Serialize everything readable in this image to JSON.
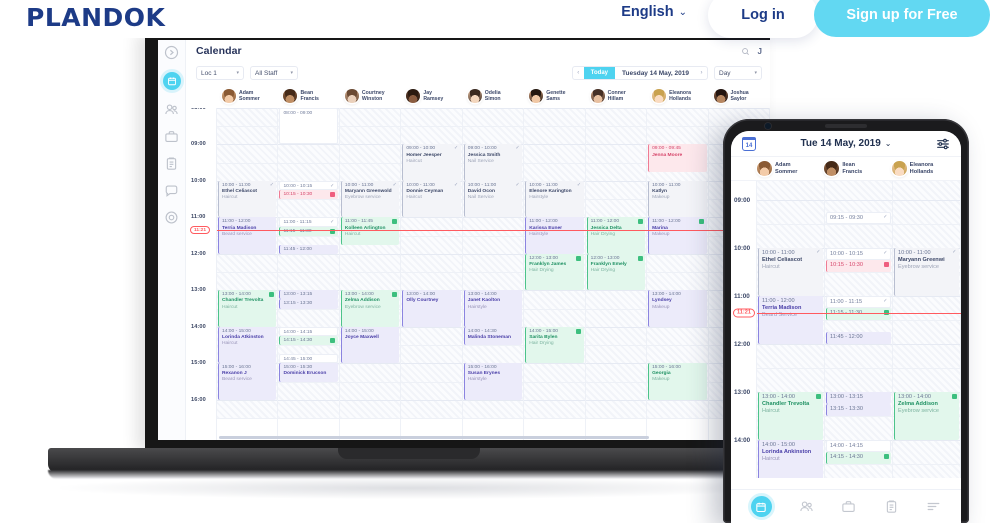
{
  "topnav": {
    "brand": "PLANDOK",
    "language": "English",
    "caret": "⌄",
    "login_label": "Log in",
    "signup_label": "Sign up for Free",
    "accent_cyan": "#62d8f2",
    "brand_navy": "#1d3b87"
  },
  "app": {
    "title": "Calendar",
    "avatar_initial": "J",
    "toolbar": {
      "location": "Loc 1",
      "staff_filter": "All Staff",
      "prev": "‹",
      "next": "›",
      "today": "Today",
      "date": "Tuesday 14 May, 2019",
      "view": "Day"
    },
    "staff": [
      {
        "name1": "Adam",
        "name2": "Sommer"
      },
      {
        "name1": "Bean",
        "name2": "Francis"
      },
      {
        "name1": "Courtney",
        "name2": "Winston"
      },
      {
        "name1": "Jay",
        "name2": "Ramsey"
      },
      {
        "name1": "Odelia",
        "name2": "Simon"
      },
      {
        "name1": "Genette",
        "name2": "Sams"
      },
      {
        "name1": "Conner",
        "name2": "Hillam"
      },
      {
        "name1": "Eleanora",
        "name2": "Hollands"
      },
      {
        "name1": "Joshua",
        "name2": "Saylor"
      }
    ],
    "times": [
      "08:00",
      "09:00",
      "10:00",
      "11:00",
      "12:00",
      "13:00",
      "14:00",
      "15:00",
      "16:00"
    ],
    "now_marker": "11:21",
    "appointments": [
      {
        "col": 0,
        "time": "10:00 - 11:00",
        "name": "Ethel Celiascot",
        "service": "Haircut",
        "variant": "v-grey",
        "badge": "check"
      },
      {
        "col": 0,
        "time": "11:00 - 12:00",
        "name": "Terria Madison",
        "service": "Beard service",
        "variant": "v-purple",
        "badge": ""
      },
      {
        "col": 0,
        "time": "13:00 - 14:00",
        "name": "Chandler Trevolta",
        "service": "Haircut",
        "variant": "v-green",
        "badge": "green"
      },
      {
        "col": 0,
        "time": "14:00 - 15:00",
        "name": "Lorinda Atkinston",
        "service": "Haircut",
        "variant": "v-purple",
        "badge": ""
      },
      {
        "col": 0,
        "time": "15:00 - 16:00",
        "name": "Rexanon J",
        "service": "Beard service",
        "variant": "v-purple",
        "badge": ""
      },
      {
        "col": 1,
        "time": "08:00 - 09:00",
        "name": "",
        "service": "",
        "variant": "v-white",
        "badge": ""
      },
      {
        "col": 1,
        "time": "10:00 - 10:15",
        "name": "",
        "service": "",
        "variant": "v-white",
        "badge": "check"
      },
      {
        "col": 1,
        "time": "10:15 - 10:30",
        "name": "",
        "service": "",
        "variant": "v-red",
        "badge": "red"
      },
      {
        "col": 1,
        "time": "11:00 - 11:15",
        "name": "",
        "service": "",
        "variant": "v-white",
        "badge": "check"
      },
      {
        "col": 1,
        "time": "11:15 - 11:30",
        "name": "",
        "service": "",
        "variant": "v-green",
        "badge": "green"
      },
      {
        "col": 1,
        "time": "11:45 - 12:00",
        "name": "",
        "service": "",
        "variant": "v-purple",
        "badge": ""
      },
      {
        "col": 1,
        "time": "13:00 - 13:15",
        "name": "",
        "service": "",
        "variant": "v-purple",
        "badge": ""
      },
      {
        "col": 1,
        "time": "13:15 - 13:30",
        "name": "",
        "service": "",
        "variant": "v-purple",
        "badge": ""
      },
      {
        "col": 1,
        "time": "14:00 - 14:15",
        "name": "",
        "service": "",
        "variant": "v-white",
        "badge": ""
      },
      {
        "col": 1,
        "time": "14:15 - 14:30",
        "name": "",
        "service": "",
        "variant": "v-green",
        "badge": "green"
      },
      {
        "col": 1,
        "time": "14:45 - 15:00",
        "name": "",
        "service": "",
        "variant": "v-white",
        "badge": ""
      },
      {
        "col": 1,
        "time": "15:00 - 15:30",
        "name": "Dominick Erucson",
        "service": "",
        "variant": "v-purple",
        "badge": ""
      },
      {
        "col": 2,
        "time": "10:00 - 11:00",
        "name": "Maryann Greenwold",
        "service": "Eyebrow service",
        "variant": "v-grey",
        "badge": "check"
      },
      {
        "col": 2,
        "time": "11:00 - 11:45",
        "name": "Kolleen Arlington",
        "service": "Haircut",
        "variant": "v-green",
        "badge": "green"
      },
      {
        "col": 2,
        "time": "13:00 - 14:00",
        "name": "Zelma Addison",
        "service": "Eyebrow service",
        "variant": "v-green",
        "badge": "green"
      },
      {
        "col": 2,
        "time": "14:00 - 15:00",
        "name": "Joyce Maxwell",
        "service": "",
        "variant": "v-purple",
        "badge": ""
      },
      {
        "col": 3,
        "time": "09:00 - 10:00",
        "name": "Homer Jeesper",
        "service": "Haircut",
        "variant": "v-grey",
        "badge": "check"
      },
      {
        "col": 3,
        "time": "10:00 - 11:00",
        "name": "Donnie Ceyman",
        "service": "Haircut",
        "variant": "v-grey",
        "badge": "check"
      },
      {
        "col": 3,
        "time": "13:00 - 14:00",
        "name": "Olly Courtney",
        "service": "",
        "variant": "v-purple",
        "badge": ""
      },
      {
        "col": 4,
        "time": "09:00 - 10:00",
        "name": "Jessica Smith",
        "service": "Nail Service",
        "variant": "v-grey",
        "badge": "check"
      },
      {
        "col": 4,
        "time": "10:00 - 11:00",
        "name": "David Ocon",
        "service": "Nail Service",
        "variant": "v-grey",
        "badge": "check"
      },
      {
        "col": 4,
        "time": "13:00 - 14:00",
        "name": "Janet Kaolton",
        "service": "Hairstyle",
        "variant": "v-purple",
        "badge": ""
      },
      {
        "col": 4,
        "time": "14:00 - 14:30",
        "name": "Malinda Stoneman",
        "service": "",
        "variant": "v-purple",
        "badge": ""
      },
      {
        "col": 4,
        "time": "15:00 - 16:00",
        "name": "Susan Erynes",
        "service": "Hairstyle",
        "variant": "v-purple",
        "badge": ""
      },
      {
        "col": 5,
        "time": "10:00 - 11:00",
        "name": "Elenore Karington",
        "service": "Hairstyle",
        "variant": "v-grey",
        "badge": "check"
      },
      {
        "col": 5,
        "time": "11:00 - 12:00",
        "name": "Karissa Euner",
        "service": "Hairstyle",
        "variant": "v-purple",
        "badge": ""
      },
      {
        "col": 5,
        "time": "12:00 - 13:00",
        "name": "Franklyn James",
        "service": "Hair Drying",
        "variant": "v-green",
        "badge": "green"
      },
      {
        "col": 5,
        "time": "14:00 - 15:00",
        "name": "Sarita Bylen",
        "service": "Hair Drying",
        "variant": "v-green",
        "badge": "green"
      },
      {
        "col": 6,
        "time": "11:00 - 12:00",
        "name": "Jessica Delta",
        "service": "Hair Drying",
        "variant": "v-green",
        "badge": "green"
      },
      {
        "col": 6,
        "time": "12:00 - 13:00",
        "name": "Franklyn Emely",
        "service": "Hair Drying",
        "variant": "v-green",
        "badge": "green"
      },
      {
        "col": 7,
        "time": "09:00 - 09:45",
        "name": "Jenna Moore",
        "service": "",
        "variant": "v-red",
        "badge": ""
      },
      {
        "col": 7,
        "time": "10:00 - 11:00",
        "name": "Katlyn",
        "service": "Makeup",
        "variant": "v-grey",
        "badge": ""
      },
      {
        "col": 7,
        "time": "11:00 - 12:00",
        "name": "Marina",
        "service": "Makeup",
        "variant": "v-purple",
        "badge": "green"
      },
      {
        "col": 7,
        "time": "13:00 - 14:00",
        "name": "Lyndsey",
        "service": "Makeup",
        "variant": "v-purple",
        "badge": ""
      },
      {
        "col": 7,
        "time": "15:00 - 16:00",
        "name": "Georgia",
        "service": "Makeup",
        "variant": "v-green",
        "badge": ""
      }
    ]
  },
  "phone": {
    "date": "Tue 14 May, 2019",
    "caret": "⌄",
    "cal_day": "14",
    "staff": [
      {
        "name1": "Adam",
        "name2": "Sommer"
      },
      {
        "name1": "Ilean",
        "name2": "Francis"
      },
      {
        "name1": "Eleanora",
        "name2": "Hollands"
      }
    ],
    "times": [
      "09:00",
      "10:00",
      "11:00",
      "12:00",
      "13:00",
      "14:00"
    ],
    "now_marker": "11:21",
    "appointments": [
      {
        "col": 1,
        "time": "09:15 - 09:30",
        "name": "",
        "service": "",
        "variant": "v-white",
        "badge": "check"
      },
      {
        "col": 0,
        "time": "10:00 - 11:00",
        "name": "Ethel Celiascot",
        "service": "Haircut",
        "variant": "v-grey",
        "badge": "check"
      },
      {
        "col": 1,
        "time": "10:00 - 10:15",
        "name": "",
        "service": "",
        "variant": "v-white",
        "badge": "check"
      },
      {
        "col": 1,
        "time": "10:15 - 10:30",
        "name": "",
        "service": "",
        "variant": "v-red",
        "badge": "red"
      },
      {
        "col": 2,
        "time": "10:00 - 11:00",
        "name": "Maryann Greenwi",
        "service": "Eyebrow service",
        "variant": "v-grey",
        "badge": "check"
      },
      {
        "col": 0,
        "time": "11:00 - 12:00",
        "name": "Terria Madison",
        "service": "Beard Service",
        "variant": "v-purple",
        "badge": ""
      },
      {
        "col": 1,
        "time": "11:00 - 11:15",
        "name": "",
        "service": "",
        "variant": "v-white",
        "badge": "check"
      },
      {
        "col": 1,
        "time": "11:15 - 11:30",
        "name": "",
        "service": "",
        "variant": "v-green",
        "badge": "green"
      },
      {
        "col": 1,
        "time": "11:45 - 12:00",
        "name": "",
        "service": "",
        "variant": "v-purple",
        "badge": ""
      },
      {
        "col": 0,
        "time": "13:00 - 14:00",
        "name": "Chandler Trevolta",
        "service": "Haircut",
        "variant": "v-green",
        "badge": "green"
      },
      {
        "col": 1,
        "time": "13:00 - 13:15",
        "name": "",
        "service": "",
        "variant": "v-purple",
        "badge": ""
      },
      {
        "col": 1,
        "time": "13:15 - 13:30",
        "name": "",
        "service": "",
        "variant": "v-purple",
        "badge": ""
      },
      {
        "col": 2,
        "time": "13:00 - 14:00",
        "name": "Zelma Addison",
        "service": "Eyebrow service",
        "variant": "v-green",
        "badge": "green"
      },
      {
        "col": 0,
        "time": "14:00 - 15:00",
        "name": "Lorinda Ankinston",
        "service": "Haircut",
        "variant": "v-purple",
        "badge": ""
      },
      {
        "col": 1,
        "time": "14:00 - 14:15",
        "name": "",
        "service": "",
        "variant": "v-white",
        "badge": ""
      },
      {
        "col": 1,
        "time": "14:15 - 14:30",
        "name": "",
        "service": "",
        "variant": "v-green",
        "badge": "green"
      }
    ],
    "nav": [
      "calendar-icon",
      "clients-icon",
      "sales-icon",
      "reports-icon",
      "menu-icon"
    ]
  },
  "sidebar_icons": [
    "collapse-icon",
    "calendar-icon",
    "clients-icon",
    "sales-icon",
    "reports-icon",
    "messages-icon",
    "settings-icon"
  ]
}
